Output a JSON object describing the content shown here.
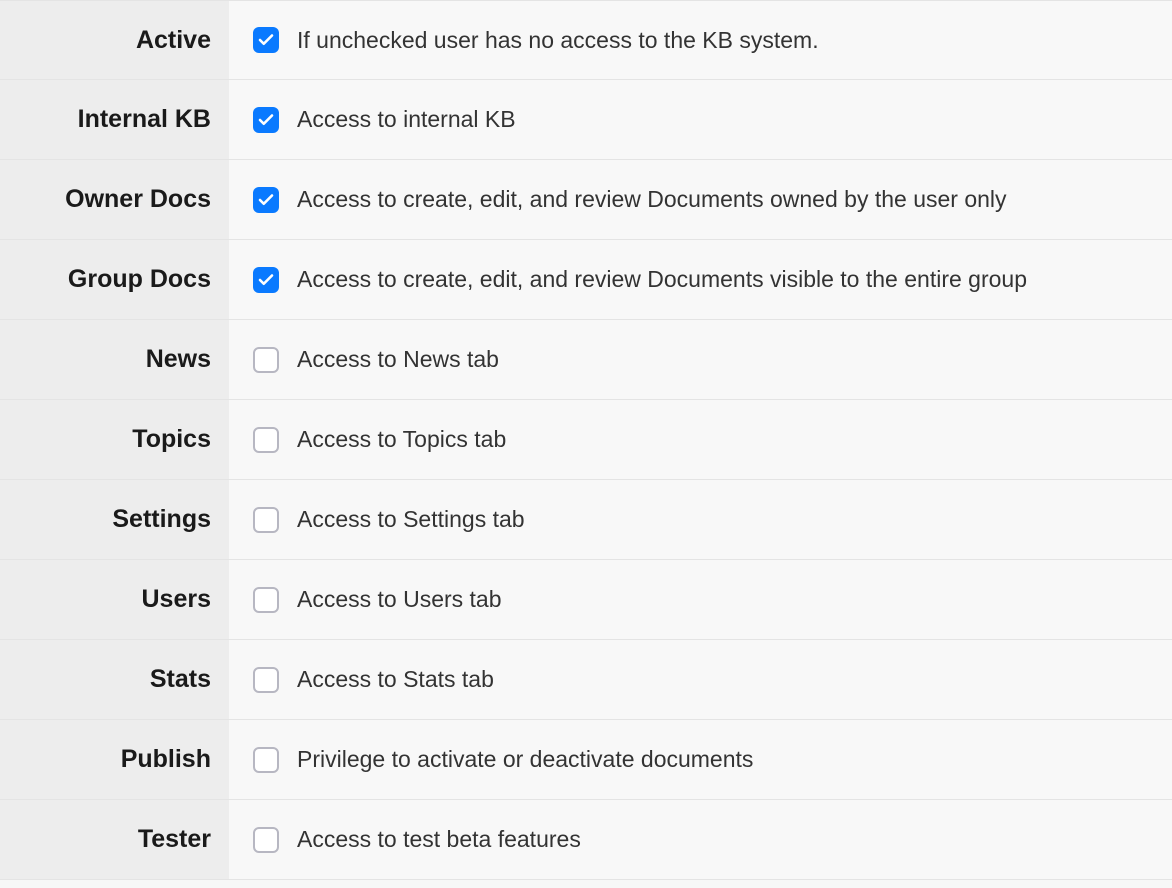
{
  "permissions": [
    {
      "key": "active",
      "label": "Active",
      "checked": true,
      "description": "If unchecked user has no access to the KB system."
    },
    {
      "key": "internal-kb",
      "label": "Internal KB",
      "checked": true,
      "description": "Access to internal KB"
    },
    {
      "key": "owner-docs",
      "label": "Owner Docs",
      "checked": true,
      "description": "Access to create, edit, and review Documents owned by the user only"
    },
    {
      "key": "group-docs",
      "label": "Group Docs",
      "checked": true,
      "description": "Access to create, edit, and review Documents visible to the entire group"
    },
    {
      "key": "news",
      "label": "News",
      "checked": false,
      "description": "Access to News tab"
    },
    {
      "key": "topics",
      "label": "Topics",
      "checked": false,
      "description": "Access to Topics tab"
    },
    {
      "key": "settings",
      "label": "Settings",
      "checked": false,
      "description": "Access to Settings tab"
    },
    {
      "key": "users",
      "label": "Users",
      "checked": false,
      "description": "Access to Users tab"
    },
    {
      "key": "stats",
      "label": "Stats",
      "checked": false,
      "description": "Access to Stats tab"
    },
    {
      "key": "publish",
      "label": "Publish",
      "checked": false,
      "description": "Privilege to activate or deactivate documents"
    },
    {
      "key": "tester",
      "label": "Tester",
      "checked": false,
      "description": "Access to test beta features"
    }
  ]
}
